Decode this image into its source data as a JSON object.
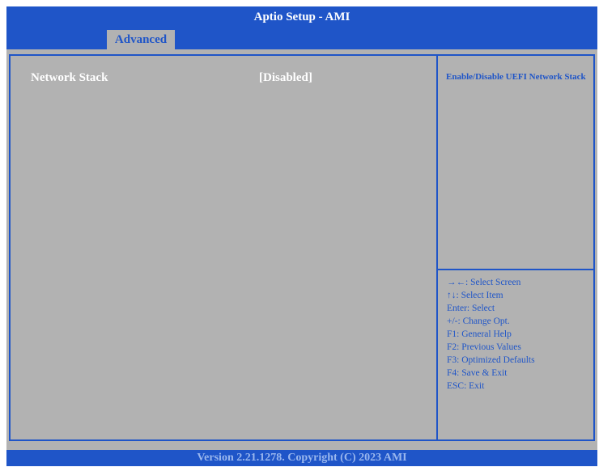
{
  "window": {
    "title": "Aptio Setup  - AMI"
  },
  "tabs": [
    {
      "label": "Advanced",
      "active": true
    }
  ],
  "settings": [
    {
      "label": "Network Stack",
      "value": "[Disabled]"
    }
  ],
  "help": {
    "text": "Enable/Disable UEFI Network Stack"
  },
  "keys": [
    "→←: Select Screen",
    "↑↓: Select Item",
    "Enter: Select",
    "+/-: Change Opt.",
    "F1: General Help",
    "F2: Previous Values",
    "F3: Optimized Defaults",
    "F4: Save & Exit",
    "ESC: Exit"
  ],
  "footer": {
    "text": "Version 2.21.1278. Copyright (C) 2023 AMI"
  },
  "colors": {
    "accent": "#1f55c8",
    "background": "#b2b2b2",
    "text": "#ffffff"
  }
}
